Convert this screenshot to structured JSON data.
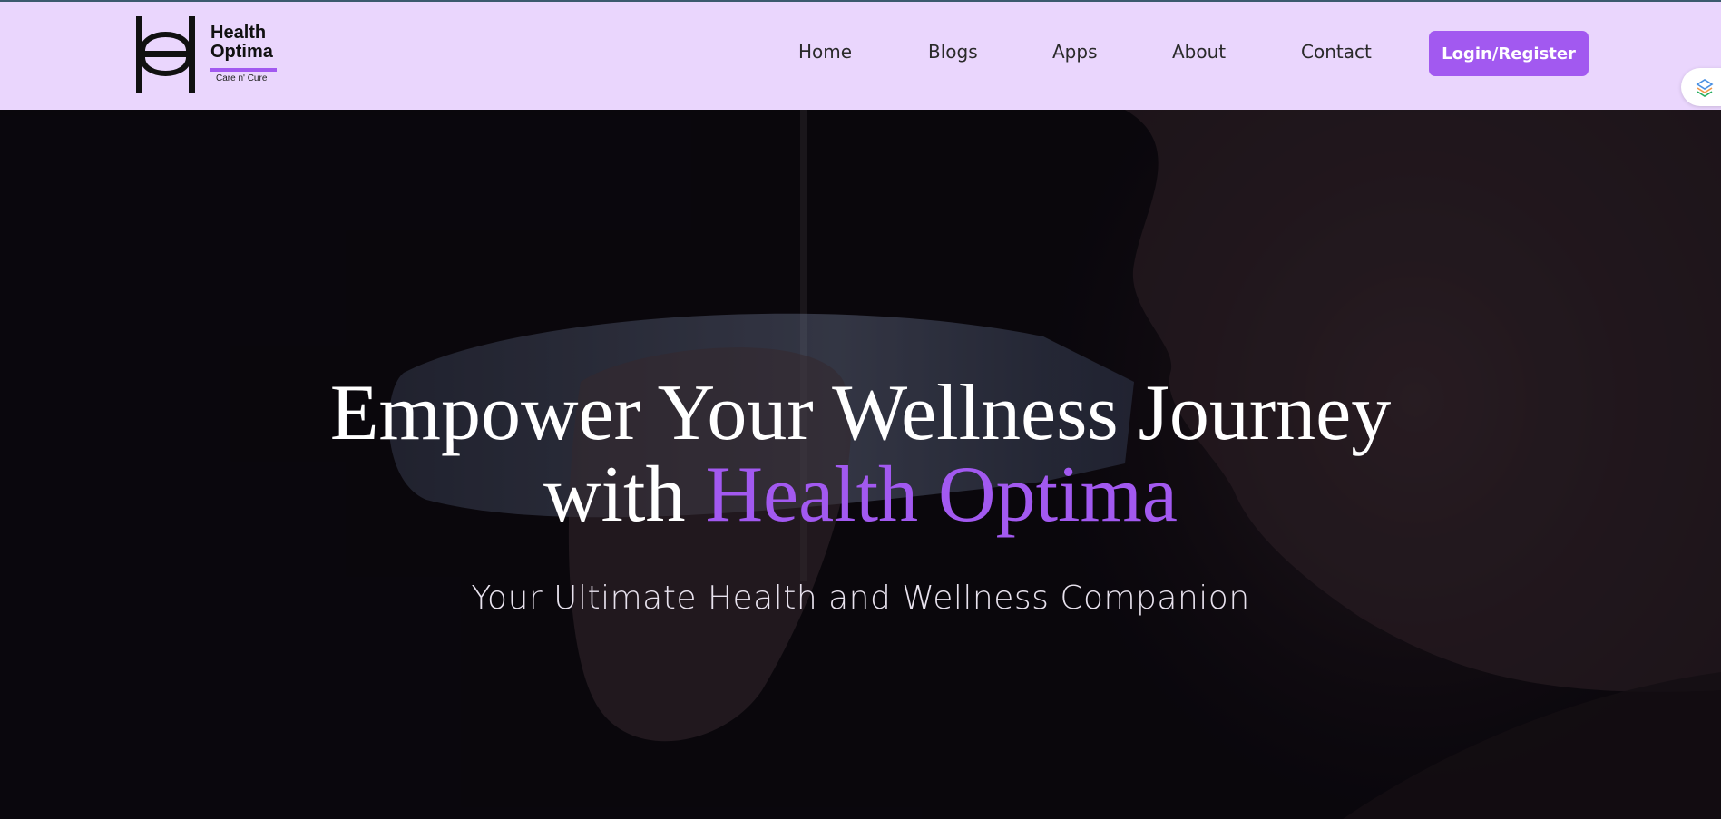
{
  "brand": {
    "name_line1": "Health",
    "name_line2": "Optima",
    "tagline": "Care n' Cure",
    "accent_color": "#a259f0",
    "header_bg": "#ead6fd"
  },
  "nav": {
    "items": [
      {
        "label": "Home"
      },
      {
        "label": "Blogs"
      },
      {
        "label": "Apps"
      },
      {
        "label": "About"
      },
      {
        "label": "Contact"
      }
    ],
    "login_label": "Login/Register"
  },
  "hero": {
    "title_part1": "Empower Your Wellness Journey",
    "title_part2": "with ",
    "title_accent": "Health Optima",
    "subtitle": "Your Ultimate Health and Wellness Companion"
  },
  "icons": {
    "logo": "health-optima-logo-icon",
    "extension": "extension-icon"
  }
}
